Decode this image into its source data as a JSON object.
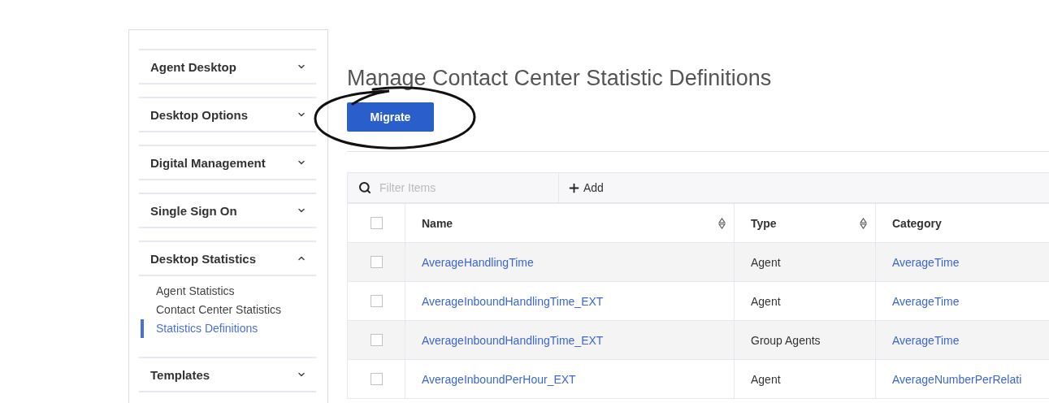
{
  "sidebar": {
    "sections": [
      {
        "title": "Agent Desktop",
        "expanded": false
      },
      {
        "title": "Desktop Options",
        "expanded": false
      },
      {
        "title": "Digital Management",
        "expanded": false
      },
      {
        "title": "Single Sign On",
        "expanded": false
      },
      {
        "title": "Desktop Statistics",
        "expanded": true,
        "items": [
          {
            "label": "Agent Statistics",
            "selected": false
          },
          {
            "label": "Contact Center Statistics",
            "selected": false
          },
          {
            "label": "Statistics Definitions",
            "selected": true
          }
        ]
      },
      {
        "title": "Templates",
        "expanded": false
      }
    ]
  },
  "page_title": "Manage Contact Center Statistic Definitions",
  "migrate_button": "Migrate",
  "toolbar": {
    "filter": {
      "placeholder": "Filter Items"
    },
    "add_button": "Add"
  },
  "table": {
    "select_all_checked": false,
    "columns": [
      {
        "label": "Name",
        "sortable": true
      },
      {
        "label": "Type",
        "sortable": true
      },
      {
        "label": "Category",
        "sortable": false
      }
    ],
    "rows": [
      {
        "checked": false,
        "name": "AverageHandlingTime",
        "type": "Agent",
        "category": "AverageTime"
      },
      {
        "checked": false,
        "name": "AverageInboundHandlingTime_EXT",
        "type": "Agent",
        "category": "AverageTime"
      },
      {
        "checked": false,
        "name": "AverageInboundHandlingTime_EXT",
        "type": "Group Agents",
        "category": "AverageTime"
      },
      {
        "checked": false,
        "name": "AverageInboundPerHour_EXT",
        "type": "Agent",
        "category": "AverageNumberPerRelati"
      }
    ]
  }
}
